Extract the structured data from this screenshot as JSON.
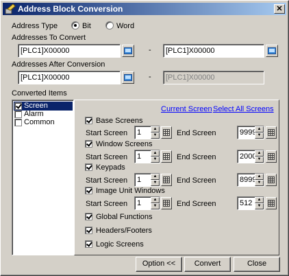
{
  "window": {
    "title": "Address Block Conversion",
    "close_glyph": "✕"
  },
  "address_type": {
    "label": "Address Type",
    "options": [
      {
        "label": "Bit",
        "selected": true
      },
      {
        "label": "Word",
        "selected": false
      }
    ]
  },
  "addresses_to_convert": {
    "label": "Addresses To Convert",
    "from_value": "[PLC1]X00000",
    "to_value": "[PLC1]X00000",
    "separator": "-"
  },
  "addresses_after_conversion": {
    "label": "Addresses After Conversion",
    "from_value": "[PLC1]X00000",
    "to_value": "[PLC1]X00000",
    "separator": "-"
  },
  "converted_items": {
    "label": "Converted Items",
    "items": [
      {
        "label": "Screen",
        "checked": true,
        "selected": true
      },
      {
        "label": "Alarm",
        "checked": false,
        "selected": false
      },
      {
        "label": "Common",
        "checked": false,
        "selected": false
      }
    ]
  },
  "screen_panel": {
    "current_screen_link": "Current Screen",
    "select_all_link": "Select All Screens",
    "start_label": "Start Screen",
    "end_label": "End Screen",
    "groups": [
      {
        "label": "Base Screens",
        "checked": true,
        "start": "1",
        "end": "9999"
      },
      {
        "label": "Window Screens",
        "checked": true,
        "start": "1",
        "end": "2000"
      },
      {
        "label": "Keypads",
        "checked": true,
        "start": "1",
        "end": "8999"
      },
      {
        "label": "Image Unit Windows",
        "checked": true,
        "start": "1",
        "end": "512"
      }
    ],
    "extras": [
      {
        "label": "Global Functions",
        "checked": true
      },
      {
        "label": "Headers/Footers",
        "checked": true
      },
      {
        "label": "Logic Screens",
        "checked": true
      }
    ]
  },
  "buttons": {
    "option": "Option <<",
    "convert": "Convert",
    "close": "Close"
  },
  "icons": {
    "title": "app-icon",
    "browse": "address-browse-icon",
    "keypad": "keypad-icon",
    "close": "close-icon"
  },
  "colors": {
    "titlebar_start": "#0a246a",
    "titlebar_end": "#a6caf0",
    "link": "#0000ff",
    "selection": "#0a246a"
  }
}
